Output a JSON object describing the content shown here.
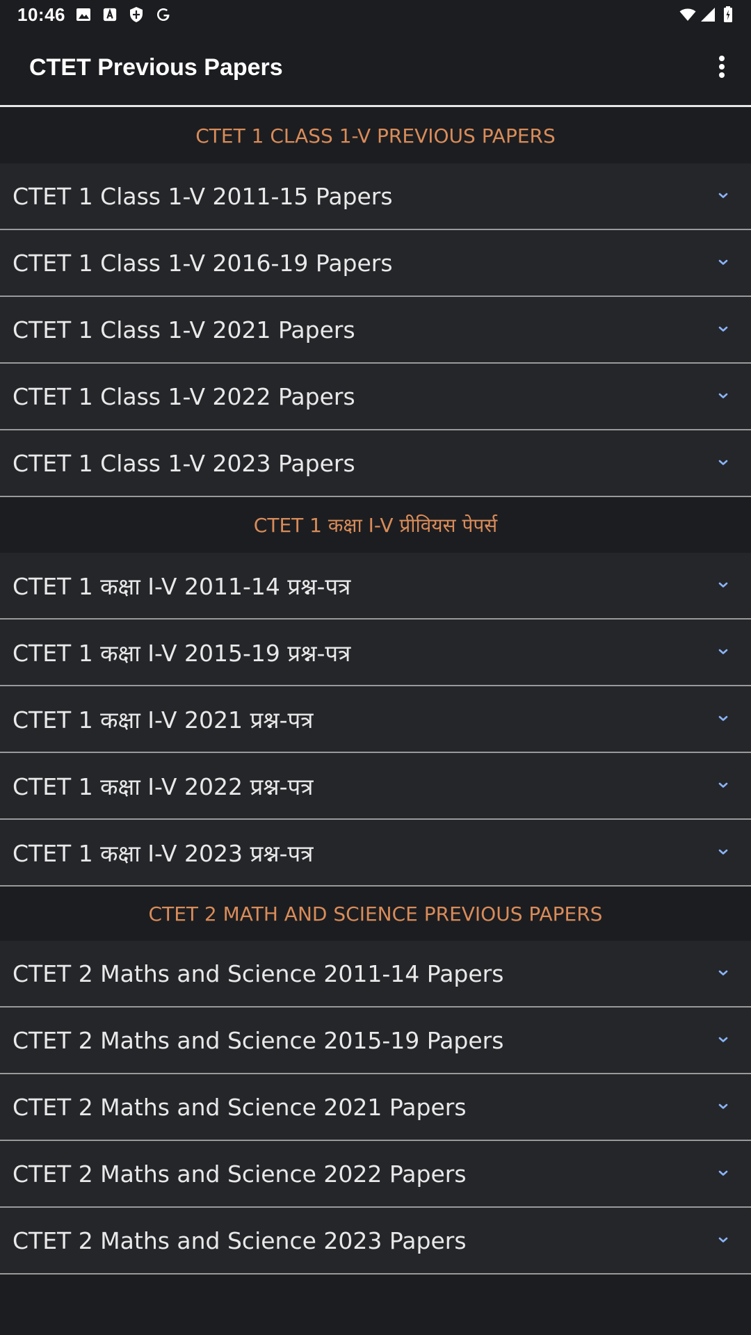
{
  "status_bar": {
    "time": "10:46",
    "icons": [
      "image-icon",
      "translate-icon",
      "shield-icon",
      "google-icon",
      "wifi-icon",
      "signal-icon",
      "battery-icon"
    ]
  },
  "app_bar": {
    "title": "CTET Previous Papers",
    "menu_icon": "more-vert-icon"
  },
  "colors": {
    "background": "#1c1d20",
    "item_background": "#25262a",
    "section_header_text": "#d98c5a",
    "chevron": "#8ab4f8",
    "divider": "#9a9a9a"
  },
  "sections": [
    {
      "header": "CTET 1 CLASS 1-V PREVIOUS PAPERS",
      "items": [
        {
          "label": "CTET 1 Class 1-V 2011-15 Papers"
        },
        {
          "label": "CTET 1 Class 1-V 2016-19 Papers"
        },
        {
          "label": "CTET 1 Class 1-V 2021 Papers"
        },
        {
          "label": "CTET 1 Class 1-V 2022 Papers"
        },
        {
          "label": "CTET 1 Class 1-V 2023 Papers"
        }
      ]
    },
    {
      "header": "CTET 1 कक्षा I-V प्रीवियस पेपर्स",
      "items": [
        {
          "label": "CTET 1 कक्षा I-V 2011-14 प्रश्न-पत्र"
        },
        {
          "label": "CTET 1 कक्षा I-V 2015-19 प्रश्न-पत्र"
        },
        {
          "label": "CTET 1 कक्षा I-V 2021 प्रश्न-पत्र"
        },
        {
          "label": "CTET 1 कक्षा I-V 2022 प्रश्न-पत्र"
        },
        {
          "label": "CTET 1 कक्षा I-V 2023 प्रश्न-पत्र"
        }
      ]
    },
    {
      "header": "CTET 2 MATH AND SCIENCE PREVIOUS PAPERS",
      "items": [
        {
          "label": "CTET 2 Maths and Science 2011-14 Papers"
        },
        {
          "label": "CTET 2 Maths and Science 2015-19 Papers"
        },
        {
          "label": "CTET 2 Maths and Science 2021 Papers"
        },
        {
          "label": "CTET 2 Maths and Science 2022 Papers"
        },
        {
          "label": "CTET 2 Maths and Science 2023 Papers"
        }
      ]
    }
  ]
}
